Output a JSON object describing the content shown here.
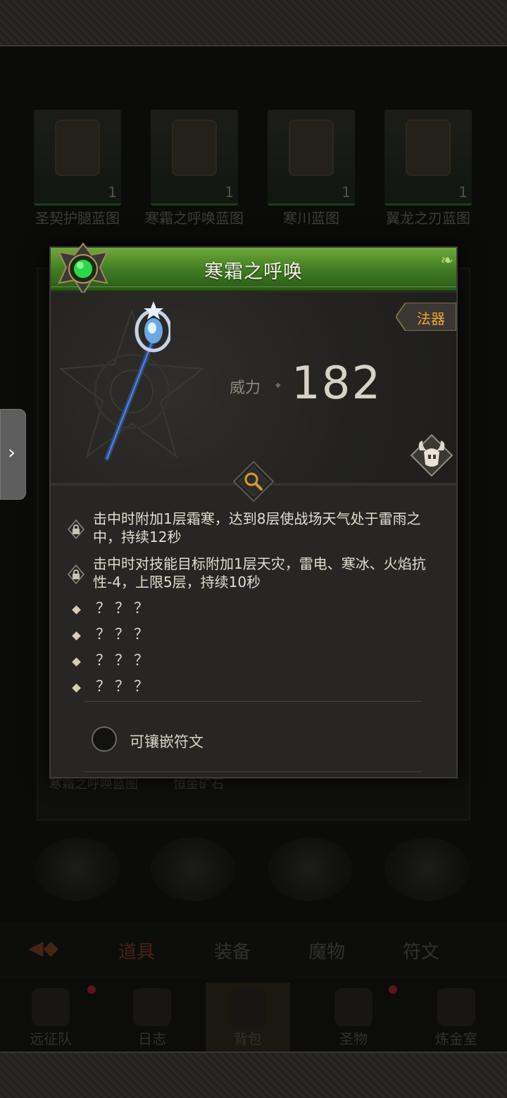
{
  "background": {
    "blueprints": [
      {
        "label": "圣契护腿蓝图",
        "count": "1"
      },
      {
        "label": "寒霜之呼唤蓝图",
        "count": "1"
      },
      {
        "label": "寒川蓝图",
        "count": "1"
      },
      {
        "label": "翼龙之刃蓝图",
        "count": "1"
      }
    ],
    "under_panel_texts": [
      "寒霜之呼唤蓝图",
      "恒金矿石"
    ],
    "tabs": [
      "道具",
      "装备",
      "魔物",
      "符文"
    ],
    "nav": [
      "远征队",
      "日志",
      "背包",
      "圣物",
      "炼金室"
    ]
  },
  "side_handle": {
    "glyph": "›"
  },
  "item": {
    "title": "寒霜之呼唤",
    "type": "法器",
    "power_label": "威力",
    "power_value": "182",
    "effects": [
      "击中时附加1层霜寒，达到8层使战场天气处于雷雨之中，持续12秒",
      "击中时对技能目标附加1层天灾，雷电、寒冰、火焰抗性-4，上限5层，持续10秒"
    ],
    "unknown_effects": [
      "？？？",
      "？？？",
      "？？？",
      "？？？"
    ],
    "socket_label": "可镶嵌符文"
  },
  "colors": {
    "header_green": "#4f8a2c",
    "type_orange": "#f0a43a",
    "panel_bg": "#272624"
  },
  "icons": {
    "emblem": "green-gem-emblem-icon",
    "weapon": "frost-staff-icon",
    "class": "horned-helmet-icon",
    "inspect": "magnifier-icon",
    "lock": "lock-icon"
  }
}
